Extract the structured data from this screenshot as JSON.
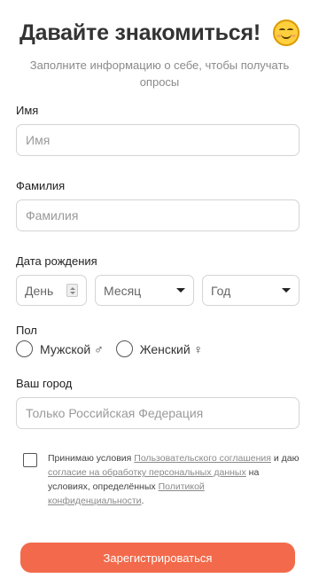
{
  "header": {
    "title": "Давайте знакомиться!",
    "emoji_icon": "smiling-face-icon",
    "subtitle": "Заполните информацию о себе, чтобы получать опросы"
  },
  "form": {
    "first_name": {
      "label": "Имя",
      "placeholder": "Имя",
      "value": ""
    },
    "last_name": {
      "label": "Фамилия",
      "placeholder": "Фамилия",
      "value": ""
    },
    "birth_date": {
      "label": "Дата рождения",
      "day_placeholder": "День",
      "month_placeholder": "Месяц",
      "year_placeholder": "Год"
    },
    "gender": {
      "label": "Пол",
      "male": "Мужской ♂",
      "female": "Женский ♀",
      "selected": null
    },
    "city": {
      "label": "Ваш город",
      "placeholder": "Только Российская Федерация",
      "value": ""
    },
    "agreement": {
      "checked": false,
      "part1": "Принимаю условия ",
      "link1": "Пользовательского соглашения",
      "part2": " и даю ",
      "link2": "согласие на обработку персональных данных",
      "part3": " на условиях, определённых ",
      "link3": "Политикой конфиденциальности",
      "part4": "."
    },
    "submit_label": "Зарегистрироваться"
  },
  "colors": {
    "accent": "#f26a4b",
    "border": "#d4d4d4",
    "muted_text": "#8a8a8a"
  }
}
